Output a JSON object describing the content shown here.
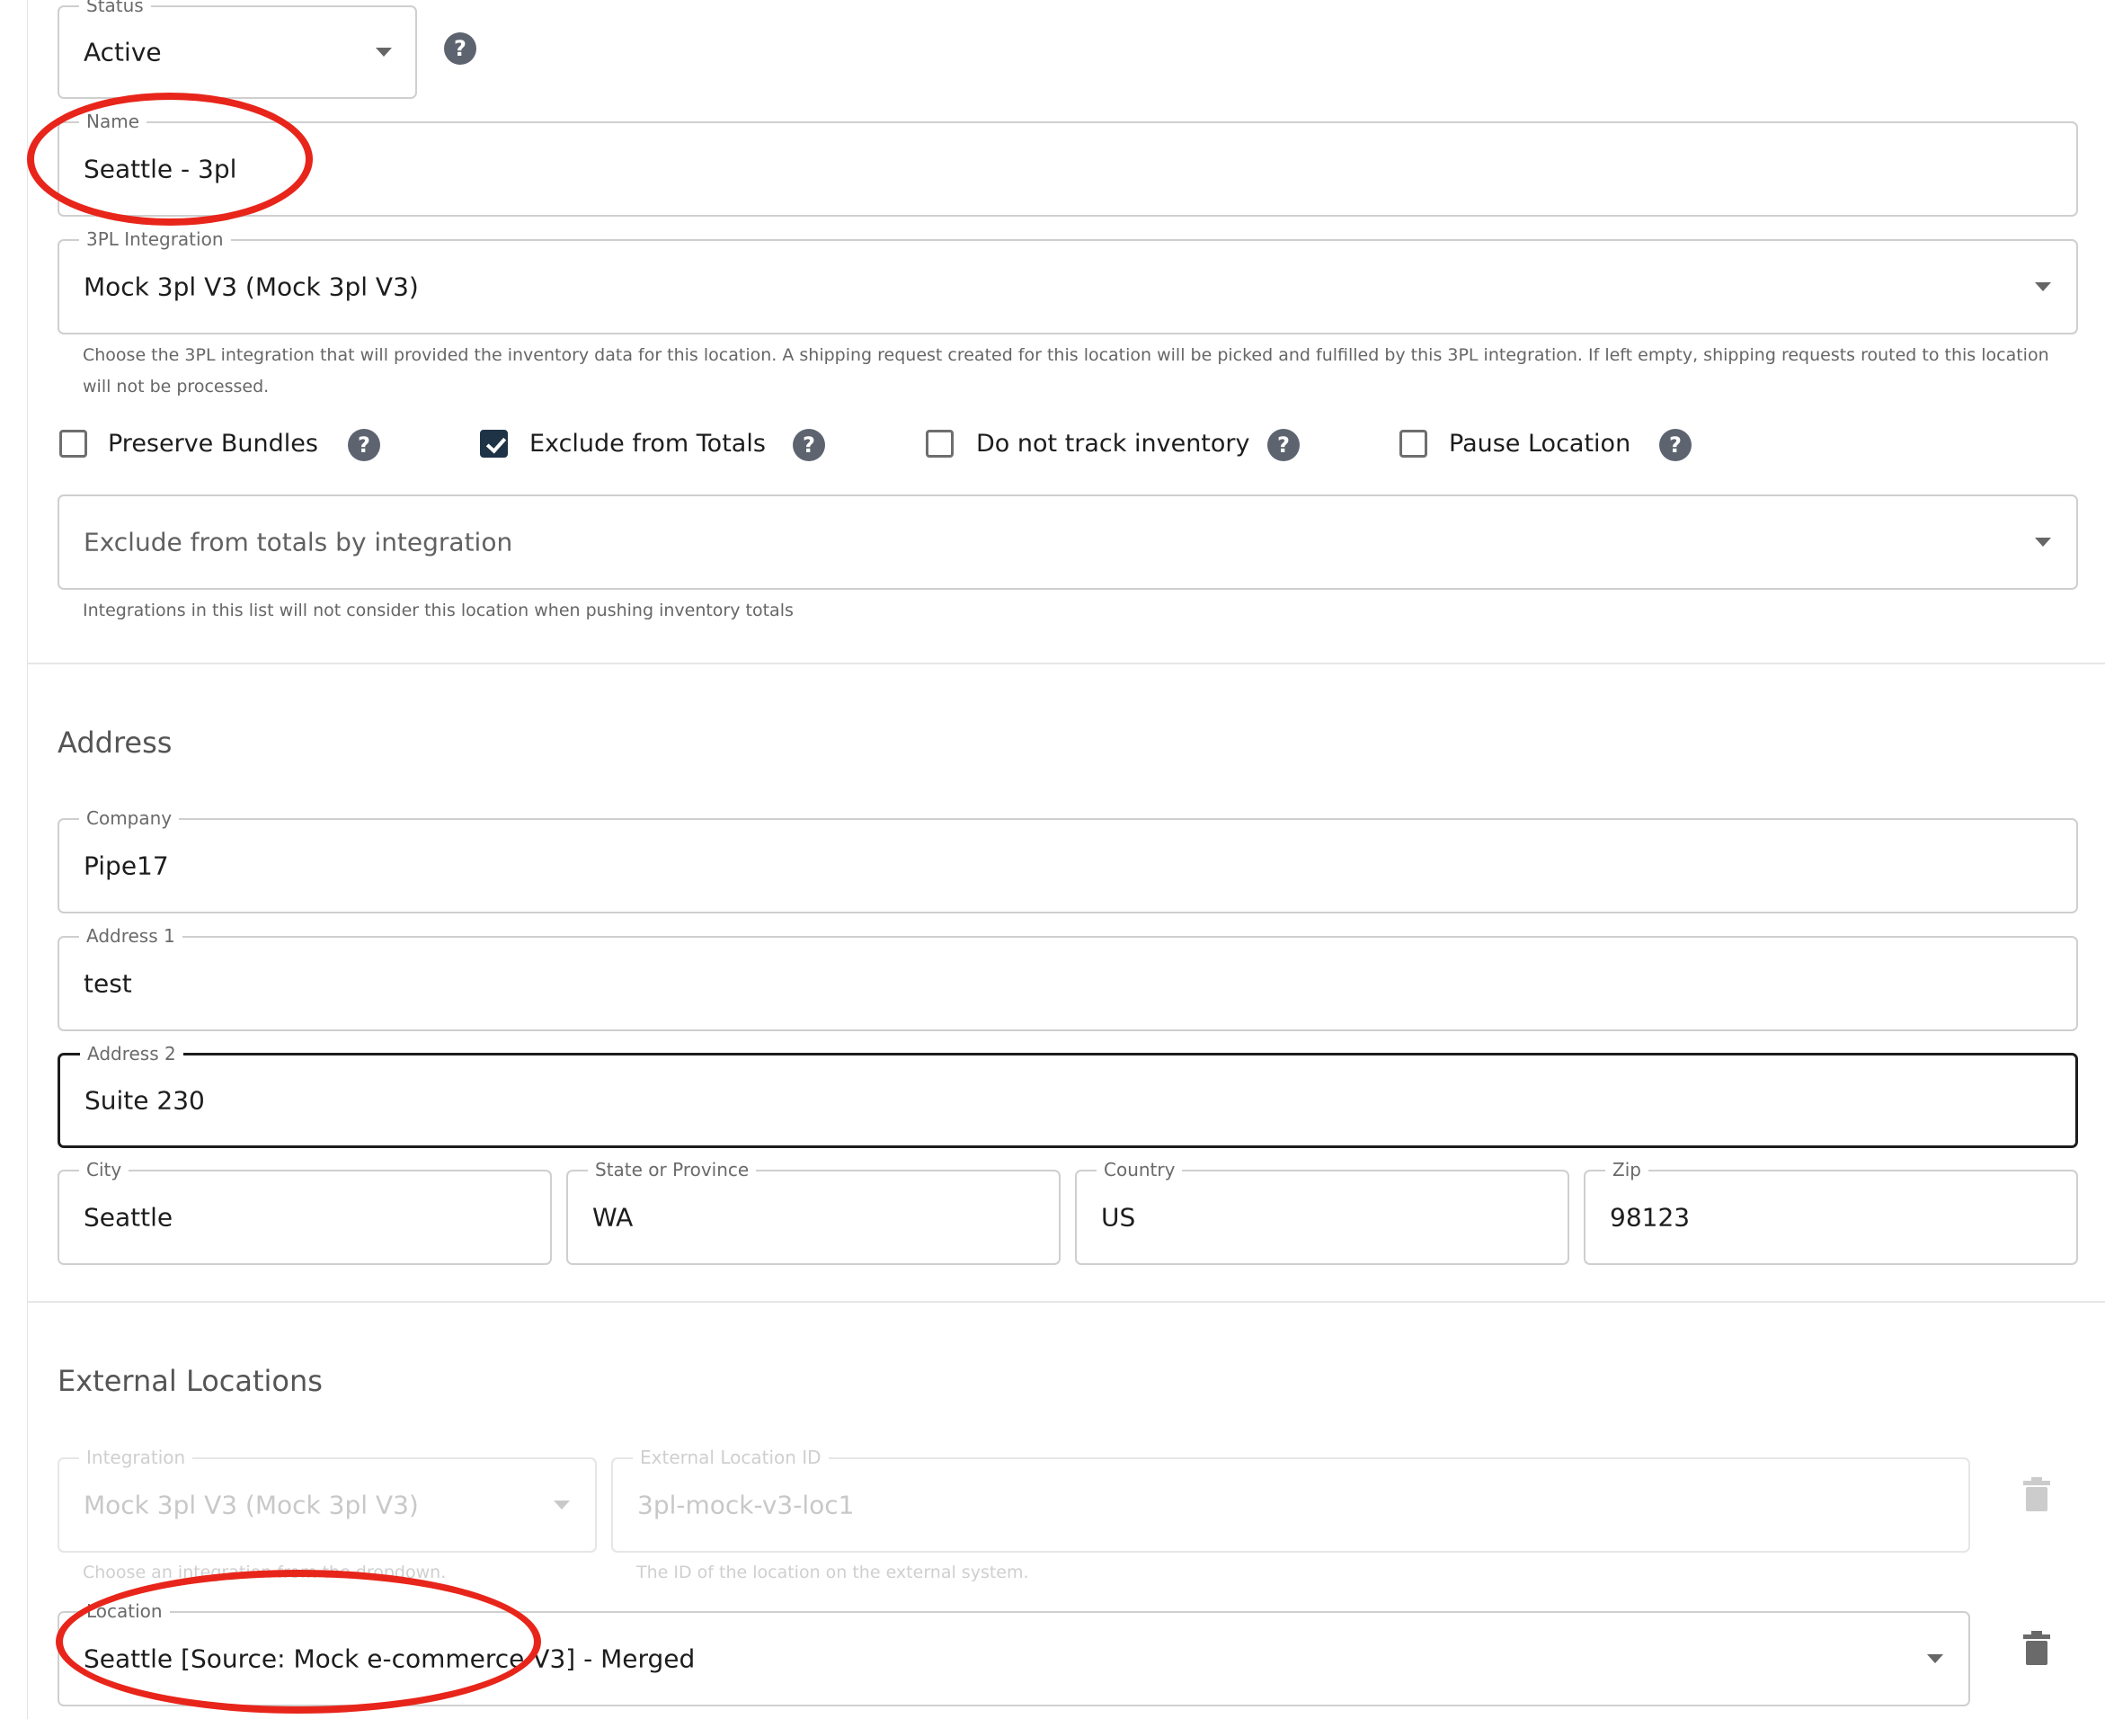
{
  "status": {
    "label": "Status",
    "value": "Active"
  },
  "name": {
    "label": "Name",
    "value": "Seattle - 3pl"
  },
  "integration_3pl": {
    "label": "3PL Integration",
    "value": "Mock 3pl V3 (Mock 3pl V3)",
    "helper_line1": "Choose the 3PL integration that will provided the inventory data for this location. A shipping request created for this location will be picked and fulfilled by this 3PL integration. If left empty, shipping requests routed to this location",
    "helper_line2": "will not be processed."
  },
  "options": [
    {
      "label": "Preserve Bundles",
      "checked": false
    },
    {
      "label": "Exclude from Totals",
      "checked": true
    },
    {
      "label": "Do not track inventory",
      "checked": false
    },
    {
      "label": "Pause Location",
      "checked": false
    }
  ],
  "exclude_by_integration": {
    "placeholder": "Exclude from totals by integration",
    "helper": "Integrations in this list will not consider this location when pushing inventory totals"
  },
  "address": {
    "title": "Address",
    "company": {
      "label": "Company",
      "value": "Pipe17"
    },
    "address1": {
      "label": "Address 1",
      "value": "test"
    },
    "address2": {
      "label": "Address 2",
      "value": "Suite 230"
    },
    "city": {
      "label": "City",
      "value": "Seattle"
    },
    "state": {
      "label": "State or Province",
      "value": "WA"
    },
    "country": {
      "label": "Country",
      "value": "US"
    },
    "zip": {
      "label": "Zip",
      "value": "98123"
    }
  },
  "external_locations": {
    "title": "External Locations",
    "row1": {
      "integration_label": "Integration",
      "integration_value": "Mock 3pl V3 (Mock 3pl V3)",
      "integration_helper": "Choose an integration from the dropdown.",
      "external_id_label": "External Location ID",
      "external_id_value": "3pl-mock-v3-loc1",
      "external_id_helper": "The ID of the location on the external system."
    },
    "row2": {
      "location_label": "Location",
      "location_value": "Seattle [Source: Mock e-commerce V3] - Merged"
    }
  },
  "colors": {
    "annotation": "#e8251a",
    "checkbox_checked": "#1e3346",
    "help_icon": "#5d6470"
  },
  "icons": {
    "help": "question-circle-icon",
    "dropdown": "caret-down-icon",
    "delete": "trash-icon"
  }
}
